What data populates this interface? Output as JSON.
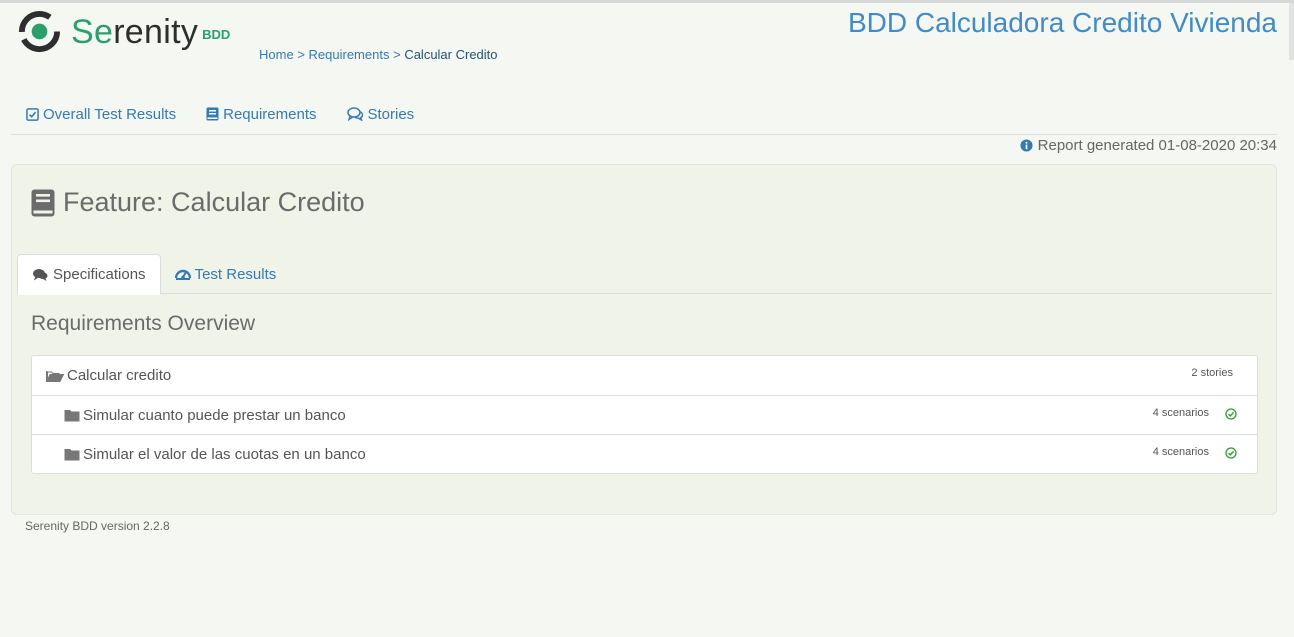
{
  "header": {
    "logo": {
      "name": "Serenity",
      "name_accent": "Se",
      "name_rest": "renity",
      "suffix": "BDD"
    },
    "project_title": "BDD Calculadora Credito Vivienda",
    "breadcrumb": [
      {
        "label": "Home"
      },
      {
        "label": "Requirements"
      },
      {
        "label": "Calcular Credito"
      }
    ],
    "breadcrumb_separator": ">"
  },
  "nav": {
    "items": [
      {
        "label": "Overall Test Results",
        "icon": "check-square-icon"
      },
      {
        "label": "Requirements",
        "icon": "book-icon"
      },
      {
        "label": "Stories",
        "icon": "comments-icon"
      }
    ]
  },
  "report_generated": "Report generated 01-08-2020 20:34",
  "feature": {
    "title": "Feature: Calcular Credito",
    "icon": "book-icon"
  },
  "tabs": [
    {
      "label": "Specifications",
      "icon": "comments-icon",
      "active": true
    },
    {
      "label": "Test Results",
      "icon": "dashboard-icon",
      "active": false
    }
  ],
  "requirements": {
    "heading": "Requirements Overview",
    "parent": {
      "label": "Calcular credito",
      "count": "2 stories",
      "icon": "folder-open-icon"
    },
    "children": [
      {
        "label": "Simular cuanto puede prestar un banco",
        "count": "4 scenarios",
        "icon": "folder-icon",
        "status": "passed"
      },
      {
        "label": "Simular el valor de las cuotas en un banco",
        "count": "4 scenarios",
        "icon": "folder-icon",
        "status": "passed"
      }
    ]
  },
  "footer": {
    "version": "Serenity BDD version 2.2.8"
  },
  "colors": {
    "link": "#337ab7",
    "brand_green": "#2aa06c",
    "success": "#2ca02c",
    "panel_bg": "#f0f4e8",
    "page_bg": "#f5f7f2",
    "title_blue": "#428bca"
  }
}
